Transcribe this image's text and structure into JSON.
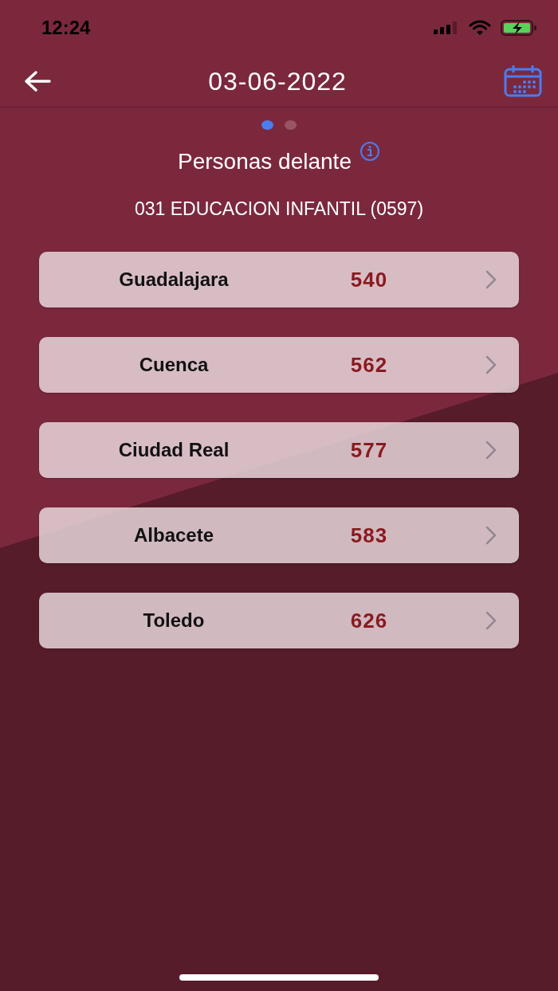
{
  "status_bar": {
    "time": "12:24"
  },
  "nav": {
    "title": "03-06-2022"
  },
  "pages": [
    {
      "selected": true
    },
    {
      "selected": false
    }
  ],
  "heading": "Personas delante",
  "subtitle": "031 EDUCACION INFANTIL (0597)",
  "rows": [
    {
      "name": "Guadalajara",
      "count": "540"
    },
    {
      "name": "Cuenca",
      "count": "562"
    },
    {
      "name": "Ciudad Real",
      "count": "577"
    },
    {
      "name": "Albacete",
      "count": "583"
    },
    {
      "name": "Toledo",
      "count": "626"
    }
  ]
}
